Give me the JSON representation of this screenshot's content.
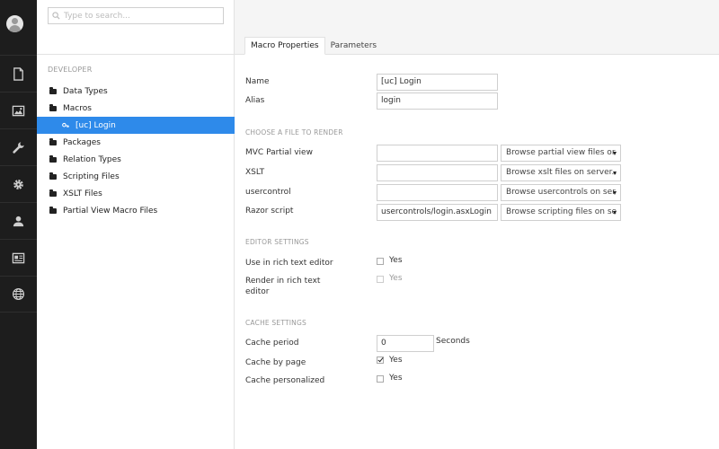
{
  "appbar": {
    "sections": [
      "content-icon",
      "media-icon",
      "settings-wrench-icon",
      "developer-gear-icon",
      "users-icon",
      "members-icon",
      "translation-globe-icon"
    ]
  },
  "tree": {
    "search_placeholder": "Type to search...",
    "section_label": "DEVELOPER",
    "items": [
      {
        "label": "Data Types"
      },
      {
        "label": "Macros"
      },
      {
        "label": "[uc] Login",
        "selected": true
      },
      {
        "label": "Packages"
      },
      {
        "label": "Relation Types"
      },
      {
        "label": "Scripting Files"
      },
      {
        "label": "XSLT Files"
      },
      {
        "label": "Partial View Macro Files"
      }
    ]
  },
  "tabs": [
    {
      "label": "Macro Properties",
      "active": true
    },
    {
      "label": "Parameters",
      "active": false
    }
  ],
  "form": {
    "name_label": "Name",
    "name_value": "[uc] Login",
    "alias_label": "Alias",
    "alias_value": "login",
    "file_section": "CHOOSE A FILE TO RENDER",
    "mvc_label": "MVC Partial view",
    "mvc_value": "",
    "mvc_select": "Browse partial view files or",
    "xslt_label": "XSLT",
    "xslt_value": "",
    "xslt_select": "Browse xslt files on server..",
    "usercontrol_label": "usercontrol",
    "usercontrol_value": "",
    "usercontrol_select": "Browse usercontrols on ser",
    "razor_label": "Razor script",
    "razor_value": "usercontrols/login.asxLogin",
    "razor_select": "Browse scripting files on se",
    "editor_section": "EDITOR SETTINGS",
    "use_rte_label": "Use in rich text editor",
    "use_rte_option": "Yes",
    "use_rte_checked": false,
    "render_rte_label_1": "Render in rich text",
    "render_rte_label_2": "editor",
    "render_rte_option": "Yes",
    "render_rte_checked": false,
    "cache_section": "CACHE SETTINGS",
    "cache_period_label": "Cache period",
    "cache_period_value": "0",
    "cache_period_unit": "Seconds",
    "cache_by_page_label": "Cache by page",
    "cache_by_page_option": "Yes",
    "cache_by_page_checked": true,
    "cache_personalized_label": "Cache personalized",
    "cache_personalized_option": "Yes",
    "cache_personalized_checked": false
  }
}
